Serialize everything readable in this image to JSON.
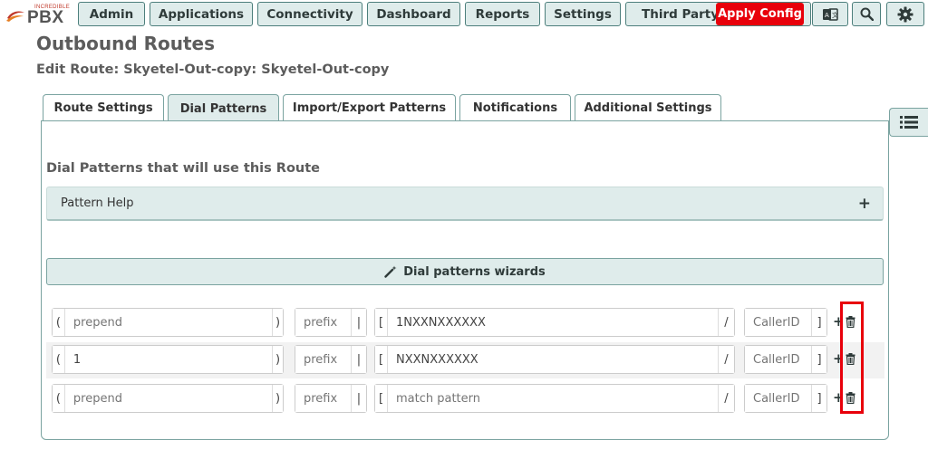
{
  "nav": {
    "logo_small": "INCREDIBLE",
    "logo_big": "PBX",
    "items": [
      {
        "label": "Admin"
      },
      {
        "label": "Applications"
      },
      {
        "label": "Connectivity"
      },
      {
        "label": "Dashboard"
      },
      {
        "label": "Reports"
      },
      {
        "label": "Settings"
      },
      {
        "label": "Third Party A"
      }
    ],
    "apply_config": "Apply Config",
    "icons": [
      "language-icon",
      "search-icon",
      "gear-icon"
    ]
  },
  "page": {
    "title": "Outbound Routes",
    "subtitle": "Edit Route: Skyetel-Out-copy: Skyetel-Out-copy"
  },
  "tabs": [
    {
      "label": "Route Settings",
      "active": false
    },
    {
      "label": "Dial Patterns",
      "active": true
    },
    {
      "label": "Import/Export Patterns",
      "active": false
    },
    {
      "label": "Notifications",
      "active": false
    },
    {
      "label": "Additional Settings",
      "active": false
    }
  ],
  "section": {
    "title": "Dial Patterns that will use this Route",
    "help_label": "Pattern Help",
    "wizard_label": "Dial patterns wizards"
  },
  "pattern_rows": [
    {
      "prepend_value": "",
      "prepend_placeholder": "prepend",
      "prefix_value": "",
      "prefix_placeholder": "prefix",
      "match_value": "1NXXNXXXXXX",
      "match_placeholder": "match pattern",
      "callerid_value": "",
      "callerid_placeholder": "CallerID"
    },
    {
      "prepend_value": "1",
      "prepend_placeholder": "prepend",
      "prefix_value": "",
      "prefix_placeholder": "prefix",
      "match_value": "NXXNXXXXXX",
      "match_placeholder": "match pattern",
      "callerid_value": "",
      "callerid_placeholder": "CallerID"
    },
    {
      "prepend_value": "",
      "prepend_placeholder": "prepend",
      "prefix_value": "",
      "prefix_placeholder": "prefix",
      "match_value": "",
      "match_placeholder": "match pattern",
      "callerid_value": "",
      "callerid_placeholder": "CallerID"
    }
  ],
  "brackets": {
    "paren_open": "(",
    "paren_close": ")",
    "pipe": "|",
    "square_open": "[",
    "slash": "/",
    "square_close": "]"
  },
  "colors": {
    "accent_bg": "#dfeceb",
    "accent_border": "#4d7f7c",
    "apply_red": "#e8000b"
  }
}
